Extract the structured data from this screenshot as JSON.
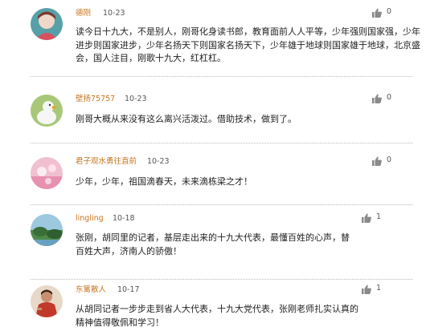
{
  "comments": [
    {
      "username": "德刚",
      "date": "10-23",
      "likes": "0",
      "text": "读今日十九大，不是别人，刚哥化身读书郎，教育面前人人平等，少年强则国家强，少年进步则国家进步，少年名扬天下则国家名扬天下，少年雄于地球则国家雄于地球，北京盛会，国人注目，刚歌十九大，红杠杠。"
    },
    {
      "username": "壁扬75757",
      "date": "10-23",
      "likes": "0",
      "text": "刚哥大概从来没有这么离兴活泼过。借助技术，做到了。"
    },
    {
      "username": "君子观水勇往直前",
      "date": "10-23",
      "likes": "0",
      "text": "少年，少年，祖国滴春天，未来滴栋梁之才！"
    },
    {
      "username": "lingling",
      "date": "10-18",
      "likes": "1",
      "text": "张刚，胡同里的记者，基层走出来的十九大代表，最懂百姓的心声，替百姓大声，济南人的骄傲！"
    },
    {
      "username": "东篱散人",
      "date": "10-17",
      "likes": "1",
      "text": "从胡同记者一步步走到省人大代表，十九大党代表，张刚老师扎实认真的精神值得敬佩和学习！"
    }
  ],
  "colors": {
    "username": "#c8741f",
    "date": "#555555",
    "content": "#222222",
    "divider": "#b8b8b8",
    "thumb": "#8a8a8a"
  },
  "icons": {
    "like": "thumbs-up-icon"
  }
}
